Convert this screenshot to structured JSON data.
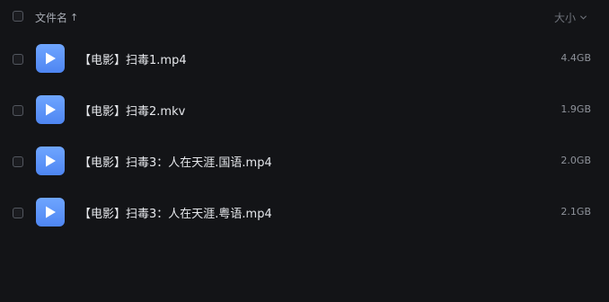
{
  "header": {
    "name_label": "文件名",
    "size_label": "大小",
    "sort_arrow_icon": "arrow-up-icon",
    "size_sort_icon": "chevron-down-icon"
  },
  "files": [
    {
      "name": "【电影】扫毒1.mp4",
      "size": "4.4GB",
      "icon": "video-play-icon"
    },
    {
      "name": "【电影】扫毒2.mkv",
      "size": "1.9GB",
      "icon": "video-play-icon"
    },
    {
      "name": "【电影】扫毒3：人在天涯.国语.mp4",
      "size": "2.0GB",
      "icon": "video-play-icon"
    },
    {
      "name": "【电影】扫毒3：人在天涯.粤语.mp4",
      "size": "2.1GB",
      "icon": "video-play-icon"
    }
  ],
  "colors": {
    "background": "#131417",
    "icon_blue": "#5b93f8"
  }
}
